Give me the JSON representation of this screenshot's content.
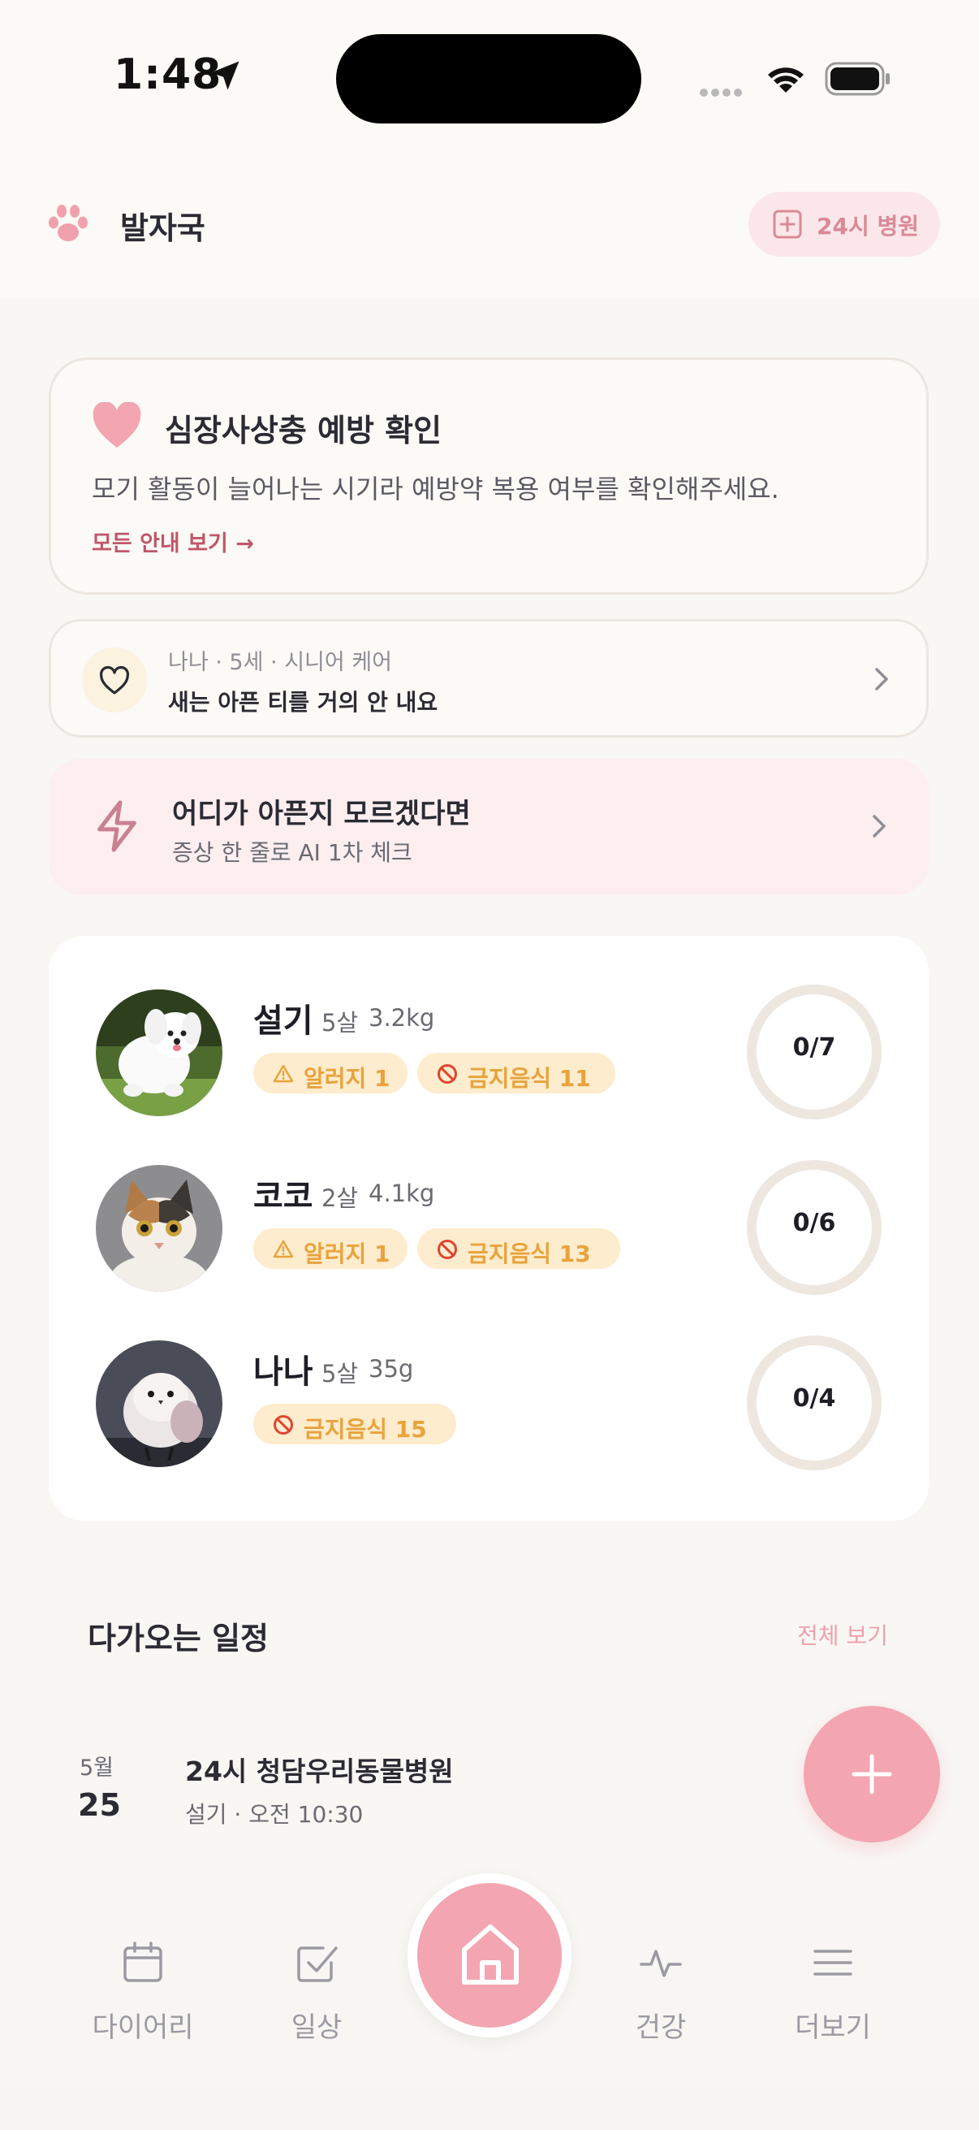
{
  "status_bar": {
    "time": "1:48"
  },
  "header": {
    "title": "발자국",
    "emergency_button": "24시 병원"
  },
  "notice": {
    "title": "심장사상충 예방 확인",
    "body": "모기 활동이 늘어나는 시기라 예방약 복용 여부를 확인해주세요.",
    "link": "모든 안내 보기 →"
  },
  "senior_card": {
    "subtitle": "나나 · 5세 · 시니어 케어",
    "text": "새는 아픈 티를 거의 안 내요"
  },
  "ai_check": {
    "title": "어디가 아픈지 모르겠다면",
    "subtitle": "증상 한 줄로 AI 1차 체크"
  },
  "pets": [
    {
      "name": "설기",
      "age": "5살",
      "weight": "3.2kg",
      "allergy": "알러지 1",
      "forbidden": "금지음식 11",
      "progress": "0/7"
    },
    {
      "name": "코코",
      "age": "2살",
      "weight": "4.1kg",
      "allergy": "알러지 1",
      "forbidden": "금지음식 13",
      "progress": "0/6"
    },
    {
      "name": "나나",
      "age": "5살",
      "weight": "35g",
      "forbidden": "금지음식 15",
      "progress": "0/4"
    }
  ],
  "schedule": {
    "title": "다가오는 일정",
    "view_all": "전체 보기",
    "items": [
      {
        "month": "5월",
        "day": "25",
        "place": "24시 청담우리동물병원",
        "detail": "설기 · 오전 10:30"
      }
    ]
  },
  "tab_bar": {
    "tabs": [
      {
        "label": "다이어리",
        "icon": "calendar-icon"
      },
      {
        "label": "일상",
        "icon": "checkbox-icon"
      },
      {
        "label": "",
        "icon": "home-icon"
      },
      {
        "label": "건강",
        "icon": "pulse-icon"
      },
      {
        "label": "더보기",
        "icon": "menu-icon"
      }
    ]
  },
  "colors": {
    "accent_pink": "#f3a5b1",
    "tag_bg": "#fdeccd",
    "tag_text": "#e8a33c",
    "link": "#c0566a",
    "background": "#f9f7f4"
  }
}
